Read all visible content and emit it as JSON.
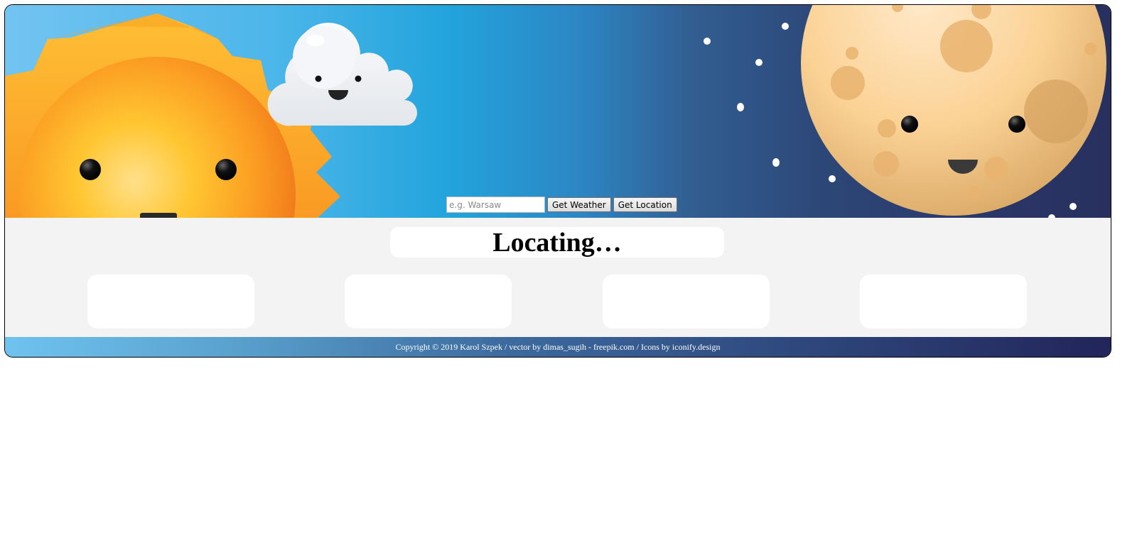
{
  "search": {
    "placeholder": "e.g. Warsaw",
    "value": "",
    "get_weather_label": "Get Weather",
    "get_location_label": "Get Location"
  },
  "status": {
    "text": "Locating…"
  },
  "forecast_cards": [
    {
      "label": ""
    },
    {
      "label": ""
    },
    {
      "label": ""
    },
    {
      "label": ""
    }
  ],
  "footer": {
    "copyright": "Copyright © 2019 Karol Szpek",
    "separator": " / ",
    "vector_credit": "vector by dimas_sugih - freepik.com",
    "icons_credit": "Icons by iconify.design"
  },
  "colors": {
    "sky_light": "#72c4f1",
    "sky_mid": "#22a4dc",
    "night": "#28305e",
    "sun": "#f7a21c",
    "moon": "#f9cf8f",
    "content_bg": "#f3f3f3"
  },
  "icons": [
    "sun-illustration",
    "cloud-illustration",
    "moon-illustration",
    "star-icon"
  ]
}
